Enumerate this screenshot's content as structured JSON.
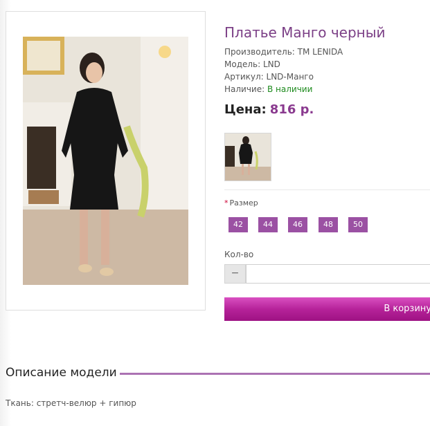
{
  "product": {
    "title": "Платье Манго черный",
    "manufacturer": {
      "label": "Производитель:",
      "value": "TM LENIDA"
    },
    "model": {
      "label": "Модель:",
      "value": "LND"
    },
    "sku": {
      "label": "Артикул:",
      "value": "LND-Манго"
    },
    "availability": {
      "label": "Наличие:",
      "value": "В наличии",
      "color": "#1d8a1d"
    },
    "price": {
      "label": "Цена:",
      "value": "816 р."
    }
  },
  "options": {
    "size": {
      "required_mark": "*",
      "label": "Размер",
      "values": [
        "42",
        "44",
        "46",
        "48",
        "50"
      ]
    }
  },
  "quantity": {
    "label": "Кол-во",
    "minus": "−",
    "value": ""
  },
  "cart_button": {
    "label": "В корзину"
  },
  "description": {
    "heading": "Описание модели",
    "text": "Ткань: стретч-велюр + гипюр"
  },
  "colors": {
    "accent": "#9b51a3",
    "title": "#7b3f86",
    "button": "#b6239a"
  }
}
